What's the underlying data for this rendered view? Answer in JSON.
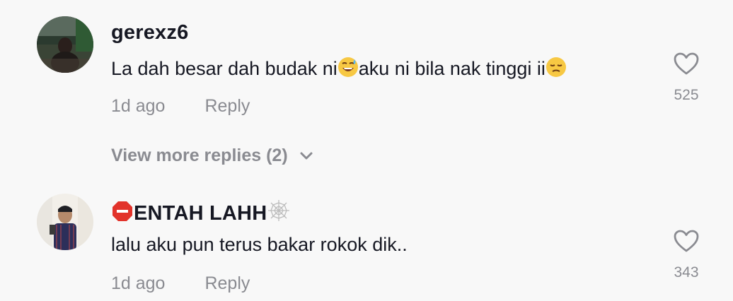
{
  "comments": [
    {
      "username": "gerexz6",
      "text_part1": "La dah besar dah budak ni",
      "emoji1": "grinning-sweat-emoji",
      "text_part2": "aku ni bila nak tinggi ii",
      "emoji2": "pensive-face-emoji",
      "time": "1d ago",
      "reply_label": "Reply",
      "likes": "525",
      "view_more": "View more replies (2)"
    },
    {
      "username_prefix_icon": "stop-sign-icon",
      "username": "ENTAH LAHH",
      "username_suffix_icon": "spider-web-icon",
      "text": "lalu aku pun terus bakar rokok dik..",
      "time": "1d ago",
      "reply_label": "Reply",
      "likes": "343"
    }
  ],
  "colors": {
    "background": "#f8f8f8",
    "text_primary": "#161823",
    "text_secondary": "#8a8b91"
  }
}
